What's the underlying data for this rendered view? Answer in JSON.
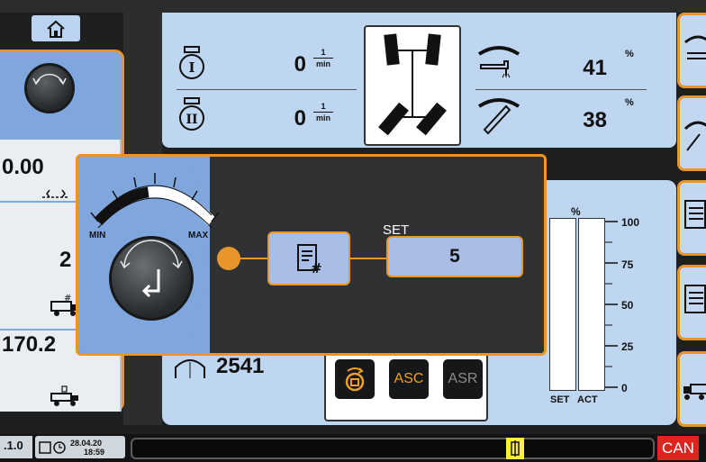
{
  "header": {
    "home_icon": "home-icon"
  },
  "left_panel": {
    "value_top": "0.00",
    "value_count": "2",
    "value_bottom": "170.2"
  },
  "engine": {
    "engine1_value": "0",
    "engine2_value": "0",
    "unit_num": "1",
    "unit_den": "min",
    "rpm": "2541"
  },
  "levels": {
    "upper_value": "41",
    "upper_unit": "%",
    "lower_value": "38",
    "lower_unit": "%"
  },
  "dialog": {
    "min_label": "MIN",
    "max_label": "MAX",
    "set_label": "SET",
    "set_value": "5",
    "level_fraction": 0.45
  },
  "gauge": {
    "unit": "%",
    "ticks": [
      "100",
      "75",
      "50",
      "25",
      "0"
    ],
    "label_set": "SET",
    "label_act": "ACT"
  },
  "functions": {
    "asc_label": "ASC",
    "asr_label": "ASR"
  },
  "footer": {
    "version": ".1.0",
    "date": "28.04.20",
    "time": "18:59",
    "can_label": "CAN"
  },
  "colors": {
    "accent": "#e8962c",
    "panel_blue": "#7fa7de",
    "light_blue": "#bfd6f0",
    "can_red": "#e2241e",
    "warn_yellow": "#ffef3a"
  }
}
